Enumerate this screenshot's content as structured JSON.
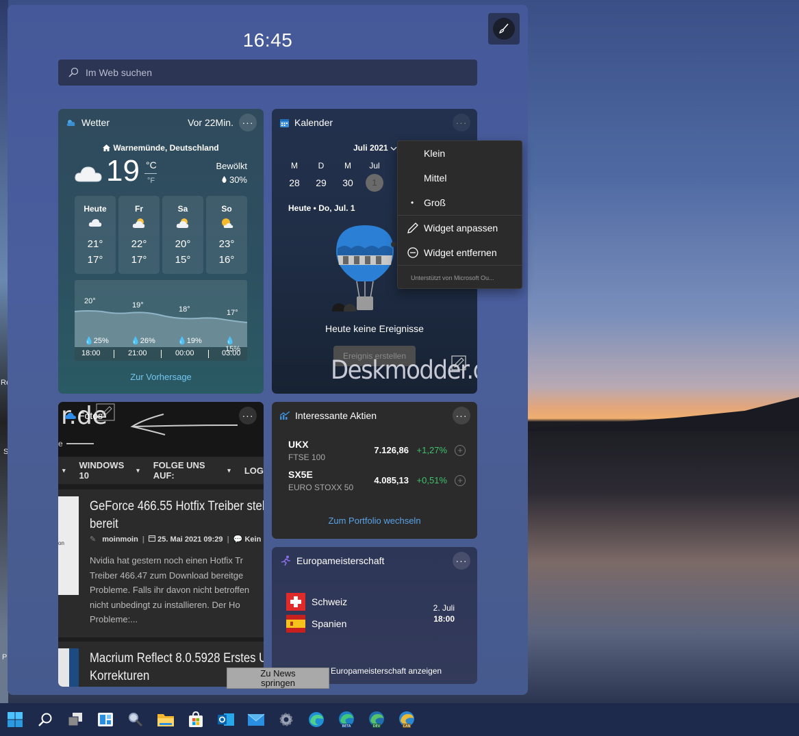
{
  "panel": {
    "clock": "16:45",
    "search_placeholder": "Im Web suchen"
  },
  "weather": {
    "title": "Wetter",
    "updated": "Vor 22Min.",
    "location": "Warnemünde, Deutschland",
    "temperature": "19",
    "unit_c": "°C",
    "unit_f": "°F",
    "condition": "Bewölkt",
    "precip": "30%",
    "days": [
      {
        "name": "Heute",
        "icon": "cloudy-icon",
        "hi": "21°",
        "lo": "17°"
      },
      {
        "name": "Fr",
        "icon": "partly-sunny-icon",
        "hi": "22°",
        "lo": "17°"
      },
      {
        "name": "Sa",
        "icon": "partly-sunny-icon",
        "hi": "20°",
        "lo": "15°"
      },
      {
        "name": "So",
        "icon": "sun-cloud-icon",
        "hi": "23°",
        "lo": "16°"
      }
    ],
    "hourly": [
      {
        "temp": "20°",
        "precip": "25%",
        "time": "18:00"
      },
      {
        "temp": "19°",
        "precip": "26%",
        "time": "21:00"
      },
      {
        "temp": "18°",
        "precip": "19%",
        "time": "00:00"
      },
      {
        "temp": "17°",
        "precip": "15%",
        "time": "03:00"
      }
    ],
    "forecast_link": "Zur Vorhersage"
  },
  "calendar": {
    "title": "Kalender",
    "month": "Juli 2021",
    "day_names": [
      "M",
      "D",
      "M",
      "Jul"
    ],
    "dates": [
      "28",
      "29",
      "30"
    ],
    "today_date": "1",
    "today_label": "Heute • Do, Jul. 1",
    "empty_text": "Heute keine Ereignisse",
    "add_button": "Ereignis erstellen",
    "watermark": "Deskmodder.de"
  },
  "context_menu": {
    "items": [
      "Klein",
      "Mittel",
      "Groß",
      "Widget anpassen",
      "Widget entfernen"
    ],
    "footer": "Unterstützt von Microsoft Ou..."
  },
  "photos": {
    "title": "Fotos",
    "banner_text": "r.de",
    "nav": [
      "WINDOWS 10",
      "FOLGE UNS AUF:",
      "LOG"
    ],
    "article1": {
      "title_line1": "GeForce 466.55 Hotfix Treiber steh",
      "title_line2": "bereit",
      "author": "moinmoin",
      "date": "25. Mai 2021 09:29",
      "comments": "Kein",
      "body": [
        "Nvidia hat gestern noch einen Hotfix Tr",
        "Treiber 466.47 zum Download bereitge",
        "Probleme. Falls ihr davon nicht betroffen",
        "nicht unbedingt zu installieren. Der Ho",
        "Probleme:..."
      ],
      "thumb_text": "on"
    },
    "article2": {
      "title_line1": "Macrium Reflect 8.0.5928 Erstes U",
      "title_line2": "Korrekturen"
    }
  },
  "stocks": {
    "title": "Interessante Aktien",
    "items": [
      {
        "symbol": "UKX",
        "name": "FTSE 100",
        "price": "7.126,86",
        "change": "+1,27%"
      },
      {
        "symbol": "SX5E",
        "name": "EURO STOXX 50",
        "price": "4.085,13",
        "change": "+0,51%"
      }
    ],
    "portfolio_link": "Zum Portfolio wechseln"
  },
  "euro": {
    "title": "Europameisterschaft",
    "team1": "Schweiz",
    "team2": "Spanien",
    "date": "2. Juli",
    "time": "18:00",
    "link": "Europameisterschaft anzeigen"
  },
  "jump_button": {
    "line1": "Zu News",
    "line2": "springen"
  },
  "desktop_side": [
    "Re",
    "S",
    "P"
  ],
  "colors": {
    "accent_link": "#74c6f0",
    "positive": "#3fc26e",
    "taskbar": "#1d2a4c"
  }
}
